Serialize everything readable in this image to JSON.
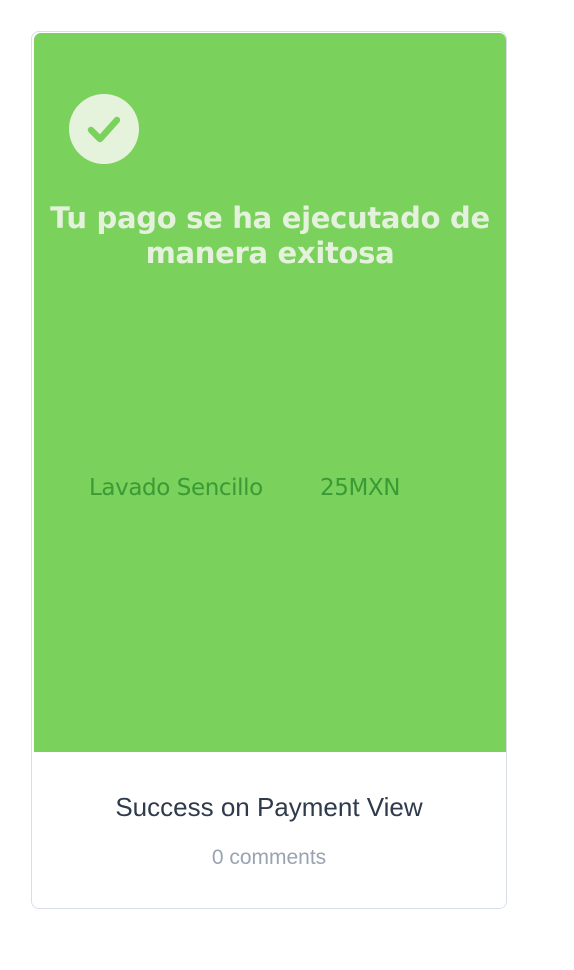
{
  "card": {
    "preview": {
      "icon": "check-circle-icon",
      "background_color": "#7ad15b",
      "success_message": "Tu pago se ha ejecutado de manera exitosa",
      "item_name": "Lavado Sencillo",
      "item_price": "25MXN"
    },
    "title": "Success on Payment View",
    "comments": "0 comments"
  }
}
